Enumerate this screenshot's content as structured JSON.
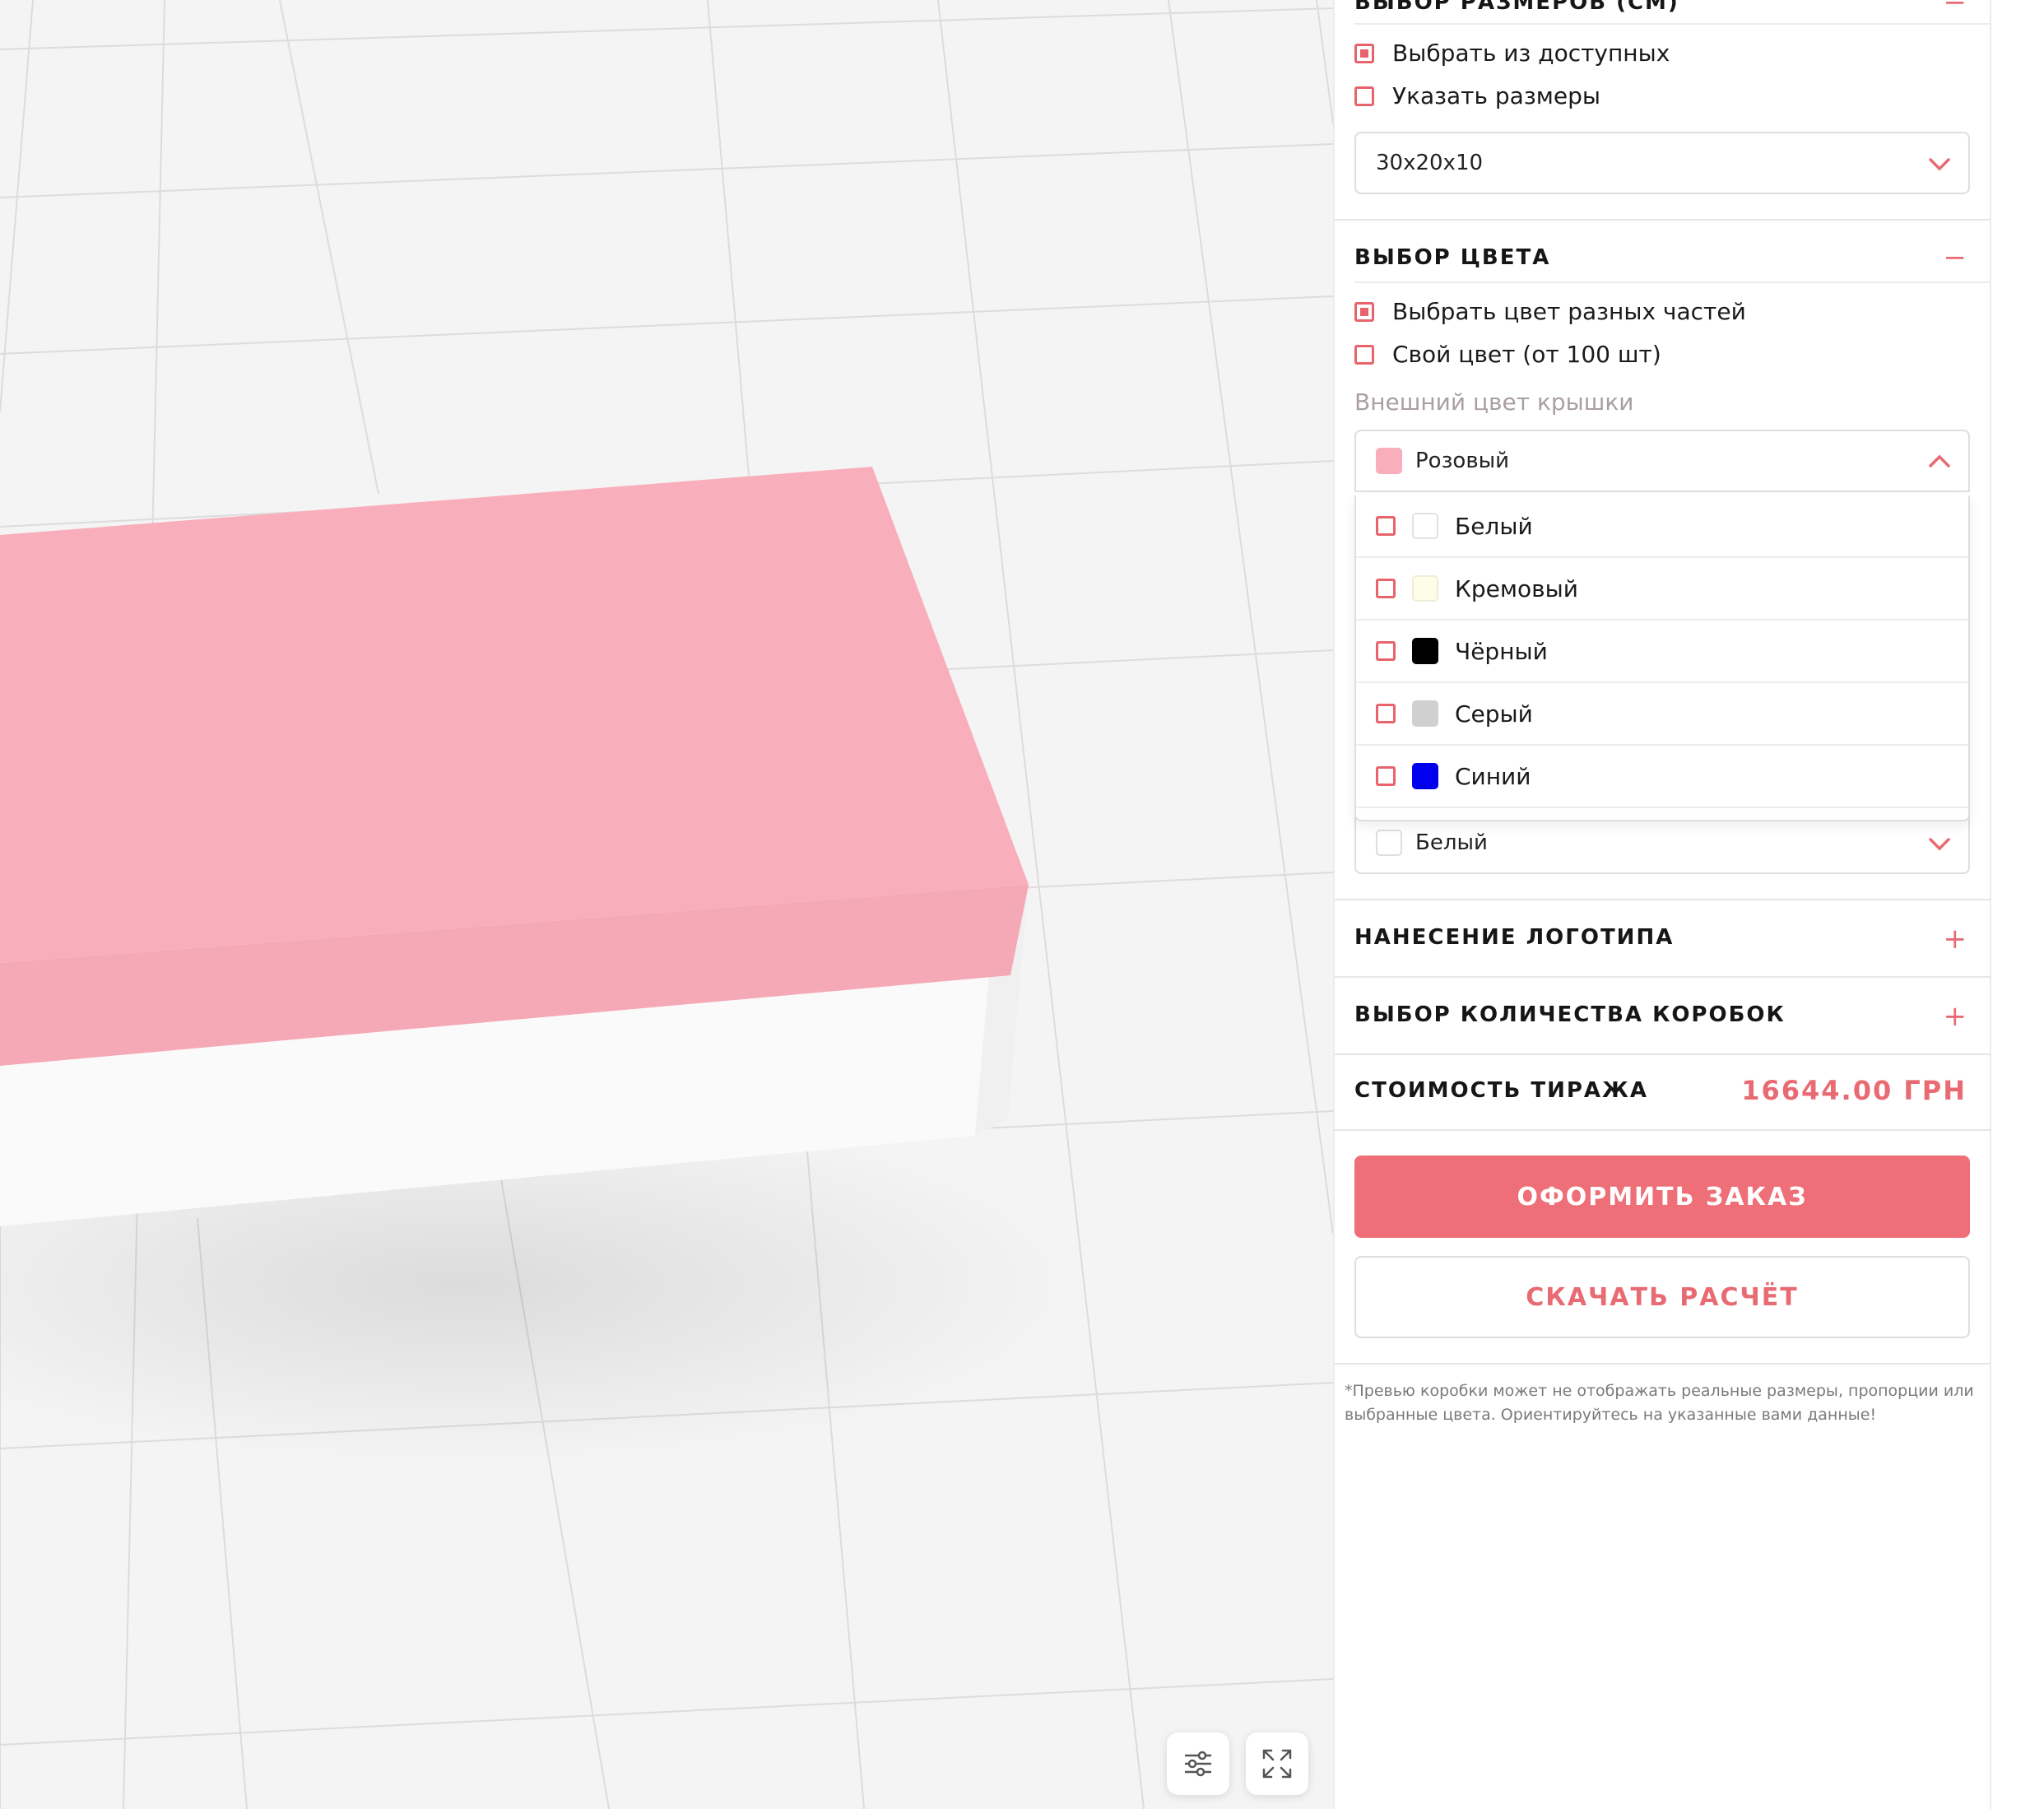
{
  "sections": {
    "size": {
      "title": "ВЫБОР РАЗМЕРОВ (СМ)",
      "toggle": "−",
      "options": [
        {
          "label": "Выбрать из доступных",
          "checked": true
        },
        {
          "label": "Указать размеры",
          "checked": false
        }
      ],
      "selected_value": "30x20x10"
    },
    "color": {
      "title": "ВЫБОР ЦВЕТА",
      "toggle": "−",
      "options": [
        {
          "label": "Выбрать цвет разных частей",
          "checked": true
        },
        {
          "label": "Свой цвет (от 100 шт)",
          "checked": false
        }
      ],
      "lid_label": "Внешний цвет крышки",
      "lid_selected": {
        "name": "Розовый",
        "color": "#f9aebc"
      },
      "dropdown_items": [
        {
          "name": "Белый",
          "color": "#ffffff"
        },
        {
          "name": "Кремовый",
          "color": "#fdfde8"
        },
        {
          "name": "Чёрный",
          "color": "#000000"
        },
        {
          "name": "Серый",
          "color": "#d0d0d0"
        },
        {
          "name": "Синий",
          "color": "#0000ee"
        }
      ],
      "second_selected": {
        "name": "Белый",
        "color": "#ffffff"
      }
    },
    "logo": {
      "title": "НАНЕСЕНИЕ ЛОГОТИПА",
      "toggle": "+"
    },
    "quantity": {
      "title": "ВЫБОР КОЛИЧЕСТВА КОРОБОК",
      "toggle": "+"
    }
  },
  "price": {
    "label": "СТОИМОСТЬ ТИРАЖА",
    "value": "16644.00 ГРН"
  },
  "buttons": {
    "order": "ОФОРМИТЬ ЗАКАЗ",
    "download": "СКАЧАТЬ РАСЧЁТ"
  },
  "note": "*Превью коробки может не отображать реальные размеры, пропорции или выбранные цвета. Ориентируйтесь на указанные вами данные!",
  "colors": {
    "accent": "#ee6f78",
    "lid": "#f9aebc",
    "base": "#fafafa",
    "viewport_bg": "#f4f4f4"
  },
  "viewport": {
    "controls": [
      "settings-sliders-icon",
      "fullscreen-icon"
    ]
  }
}
